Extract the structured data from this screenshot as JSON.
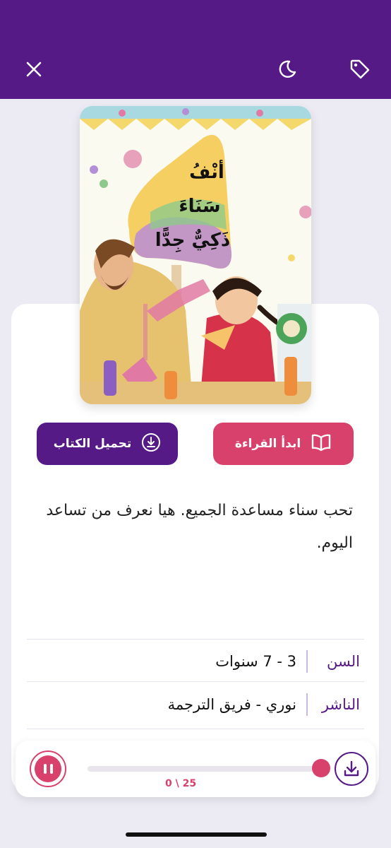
{
  "header": {
    "close_icon": "close-icon",
    "night_icon": "moon-icon",
    "tag_icon": "tag-icon",
    "background": "#561a86"
  },
  "book": {
    "cover_title_lines": [
      "أنْفُ",
      "سَنَاءَ",
      "ذَكِيٌّ جِدًّا"
    ],
    "description": "تحب سناء مساعدة الجميع. هيا نعرف من تساعد اليوم.",
    "age_label": "السن",
    "age_value": "3 - 7 سنوات",
    "publisher_label": "الناشر",
    "publisher_value": "نوري - فريق الترجمة"
  },
  "actions": {
    "read_label": "ابدأ القراءة",
    "download_label": "تحميل الكتاب"
  },
  "player": {
    "counter": "0 \\ 25",
    "progress": 0.0
  },
  "colors": {
    "primary": "#561a86",
    "accent": "#d9416d"
  }
}
